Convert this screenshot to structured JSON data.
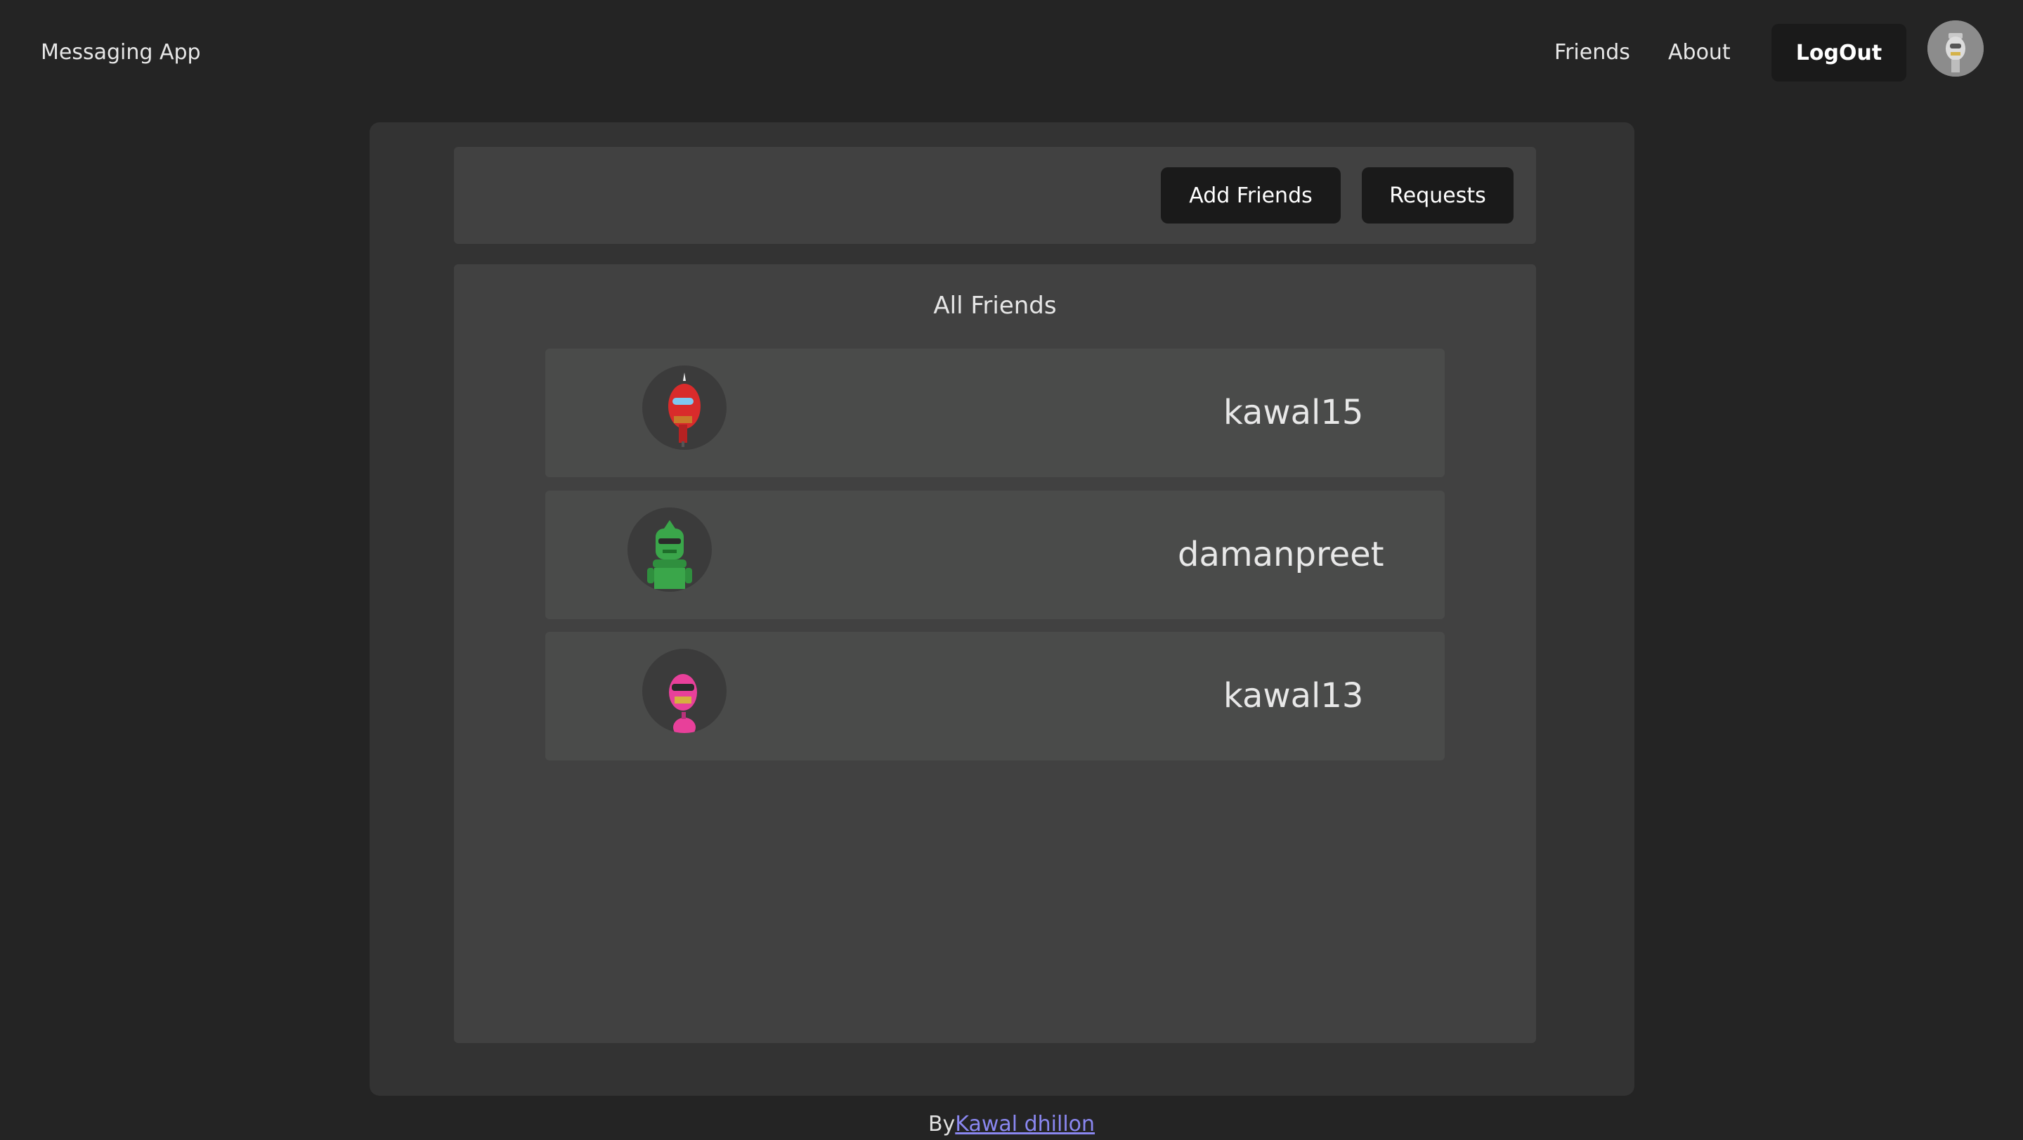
{
  "header": {
    "brand": "Messaging App",
    "nav": {
      "friends": "Friends",
      "about": "About"
    },
    "logout_label": "LogOut"
  },
  "toolbar": {
    "add_friends_label": "Add Friends",
    "requests_label": "Requests"
  },
  "friends": {
    "title": "All Friends",
    "items": [
      {
        "username": "kawal15",
        "avatar": "red-robot-avatar",
        "color": "#d92b2b"
      },
      {
        "username": "damanpreet",
        "avatar": "green-robot-avatar",
        "color": "#3aa64a"
      },
      {
        "username": "kawal13",
        "avatar": "pink-robot-avatar",
        "color": "#e8409a"
      }
    ]
  },
  "footer": {
    "prefix": "By",
    "author": "Kawal dhillon"
  },
  "colors": {
    "background": "#242424",
    "panel": "#333333",
    "card": "#414141",
    "row": "#4a4b4a",
    "button": "#1a1a1a",
    "link": "#8a87f0"
  }
}
